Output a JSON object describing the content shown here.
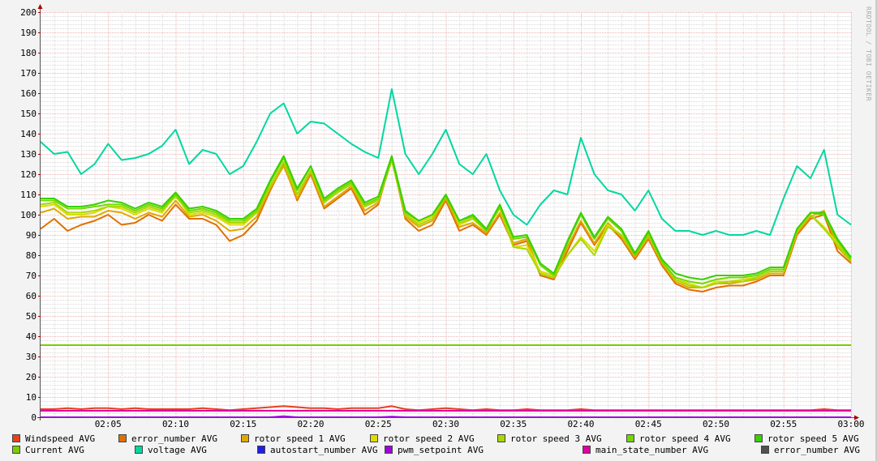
{
  "chart_data": {
    "type": "line",
    "title": "",
    "xlabel": "",
    "ylabel": "",
    "ylim": [
      0,
      200
    ],
    "yticks": [
      "0",
      "10",
      "20",
      "30",
      "40",
      "50",
      "60",
      "70",
      "80",
      "90",
      "100",
      "110",
      "120",
      "130",
      "140",
      "150",
      "160",
      "170",
      "180",
      "190",
      "200"
    ],
    "xticks": [
      "02:05",
      "02:10",
      "02:15",
      "02:20",
      "02:25",
      "02:30",
      "02:35",
      "02:40",
      "02:45",
      "02:50",
      "02:55",
      "03:00"
    ],
    "x_start_minute": 0,
    "x_end_minute": 60,
    "grid": true,
    "legend_position": "bottom",
    "series": [
      {
        "name": "Windspeed AVG",
        "color": "#e8401c",
        "values": [
          4,
          4,
          4.5,
          4,
          4.5,
          4.5,
          4,
          4.5,
          4,
          4,
          4,
          4,
          4.5,
          4,
          3.5,
          4,
          4.5,
          5,
          5.5,
          5,
          4.5,
          4.5,
          4,
          4.5,
          4.5,
          4.5,
          5.5,
          4,
          3.5,
          4,
          4.5,
          4,
          3.5,
          4,
          3.5,
          3.5,
          4,
          3.5,
          3.5,
          3.5,
          4,
          3.5,
          3.5,
          3.5,
          3.5,
          3.5,
          3.5,
          3.5,
          3.5,
          3.5,
          3.5,
          3.5,
          3.5,
          3.5,
          3.5,
          3.5,
          3.5,
          3.5,
          4,
          3.5,
          3.5
        ]
      },
      {
        "name": "error_number AVG",
        "color": "#e07000",
        "values": [
          93,
          98,
          92,
          95,
          97,
          100,
          95,
          96,
          100,
          97,
          105,
          98,
          98,
          95,
          87,
          90,
          97,
          112,
          125,
          107,
          120,
          103,
          108,
          113,
          100,
          105,
          128,
          98,
          92,
          95,
          107,
          92,
          95,
          90,
          100,
          85,
          87,
          70,
          68,
          82,
          96,
          85,
          95,
          88,
          78,
          88,
          75,
          66,
          63,
          62,
          64,
          65,
          65,
          67,
          70,
          70,
          90,
          98,
          100,
          82,
          76
        ]
      },
      {
        "name": "rotor speed 1 AVG",
        "color": "#e0a800",
        "values": [
          101,
          103,
          98,
          99,
          99,
          102,
          101,
          98,
          101,
          99,
          107,
          99,
          100,
          97,
          92,
          93,
          99,
          113,
          124,
          108,
          121,
          104,
          109,
          114,
          102,
          106,
          127,
          99,
          94,
          97,
          108,
          94,
          96,
          91,
          101,
          86,
          88,
          71,
          69,
          84,
          97,
          86,
          96,
          89,
          79,
          89,
          76,
          67,
          64,
          64,
          66,
          66,
          67,
          68,
          71,
          71,
          91,
          99,
          102,
          84,
          77
        ]
      },
      {
        "name": "rotor speed 2 AVG",
        "color": "#dcdc00",
        "values": [
          104,
          105,
          100,
          100,
          101,
          104,
          103,
          100,
          103,
          101,
          110,
          100,
          101,
          99,
          95,
          95,
          101,
          114,
          126,
          110,
          122,
          106,
          111,
          115,
          104,
          108,
          128,
          100,
          96,
          99,
          110,
          95,
          98,
          93,
          103,
          84,
          85,
          72,
          70,
          80,
          89,
          82,
          95,
          90,
          80,
          90,
          77,
          68,
          66,
          64,
          67,
          67,
          68,
          69,
          72,
          72,
          92,
          100,
          94,
          86,
          78
        ]
      },
      {
        "name": "rotor speed 3 AVG",
        "color": "#a8d800",
        "values": [
          105,
          106,
          101,
          101,
          102,
          104,
          104,
          101,
          104,
          102,
          109,
          101,
          102,
          100,
          96,
          96,
          101,
          114,
          126,
          110,
          122,
          106,
          111,
          115,
          104,
          107,
          127,
          100,
          95,
          98,
          109,
          96,
          98,
          92,
          104,
          84,
          83,
          71,
          69,
          80,
          88,
          80,
          94,
          90,
          80,
          90,
          77,
          68,
          65,
          64,
          66,
          67,
          67,
          69,
          72,
          72,
          92,
          100,
          93,
          85,
          77
        ]
      },
      {
        "name": "rotor speed 4 AVG",
        "color": "#70d800",
        "values": [
          107,
          107,
          103,
          103,
          104,
          105,
          105,
          102,
          105,
          103,
          110,
          102,
          103,
          101,
          97,
          97,
          102,
          116,
          128,
          112,
          124,
          107,
          112,
          116,
          105,
          108,
          128,
          101,
          97,
          100,
          109,
          97,
          99,
          92,
          104,
          88,
          89,
          75,
          70,
          86,
          100,
          88,
          98,
          92,
          80,
          91,
          77,
          69,
          67,
          66,
          68,
          69,
          69,
          70,
          73,
          73,
          93,
          101,
          100,
          87,
          78
        ]
      },
      {
        "name": "rotor speed 5 AVG",
        "color": "#38d000",
        "values": [
          108,
          108,
          104,
          104,
          105,
          107,
          106,
          103,
          106,
          104,
          111,
          103,
          104,
          102,
          98,
          98,
          103,
          117,
          129,
          113,
          124,
          108,
          113,
          117,
          106,
          109,
          129,
          102,
          97,
          100,
          110,
          97,
          100,
          93,
          105,
          89,
          90,
          76,
          71,
          87,
          101,
          89,
          99,
          93,
          81,
          92,
          78,
          71,
          69,
          68,
          70,
          70,
          70,
          71,
          74,
          74,
          93,
          101,
          101,
          88,
          79
        ]
      },
      {
        "name": "Current AVG",
        "color": "#7acc00",
        "values": [
          35.6,
          35.6,
          35.6,
          35.6,
          35.6,
          35.6,
          35.6,
          35.6,
          35.6,
          35.6,
          35.6,
          35.6,
          35.6,
          35.6,
          35.6,
          35.6,
          35.6,
          35.6,
          35.6,
          35.6,
          35.6,
          35.6,
          35.6,
          35.6,
          35.6,
          35.6,
          35.6,
          35.6,
          35.6,
          35.6,
          35.6,
          35.6,
          35.6,
          35.6,
          35.6,
          35.6,
          35.6,
          35.6,
          35.6,
          35.6,
          35.6,
          35.6,
          35.6,
          35.6,
          35.6,
          35.6,
          35.6,
          35.6,
          35.6,
          35.6,
          35.6,
          35.6,
          35.6,
          35.6,
          35.6,
          35.6,
          35.6,
          35.6,
          35.6,
          35.6,
          35.6
        ]
      },
      {
        "name": "voltage AVG",
        "color": "#00d8a0",
        "values": [
          136,
          130,
          131,
          120,
          125,
          135,
          127,
          128,
          130,
          134,
          142,
          125,
          132,
          130,
          120,
          124,
          136,
          150,
          155,
          140,
          146,
          145,
          140,
          135,
          131,
          128,
          162,
          130,
          120,
          130,
          142,
          125,
          120,
          130,
          112,
          100,
          95,
          105,
          112,
          110,
          138,
          120,
          112,
          110,
          102,
          112,
          98,
          92,
          92,
          90,
          92,
          90,
          90,
          92,
          90,
          108,
          124,
          118,
          132,
          100,
          95
        ]
      },
      {
        "name": "autostart_number AVG",
        "color": "#2020e0",
        "values": []
      },
      {
        "name": "pwm_setpoint AVG",
        "color": "#a000e0",
        "values": [
          0,
          0,
          0,
          0,
          0,
          0,
          0,
          0,
          0,
          0,
          0,
          0,
          0,
          0,
          0,
          0,
          0,
          0,
          0.5,
          0,
          0,
          0,
          0,
          0,
          0,
          0,
          0.3,
          0,
          0,
          0,
          0,
          0,
          0,
          0,
          0,
          0,
          0,
          0,
          0,
          0,
          0,
          0,
          0,
          0,
          0,
          0,
          0,
          0,
          0,
          0,
          0,
          0,
          0,
          0,
          0,
          0,
          0,
          0,
          0,
          0,
          0
        ]
      },
      {
        "name": "main_state_number AVG",
        "color": "#e000a0",
        "values": [
          3.2,
          3.2,
          3.2,
          3.2,
          3.2,
          3.2,
          3.2,
          3.2,
          3.2,
          3.2,
          3.2,
          3.2,
          3.2,
          3.2,
          3.2,
          3.2,
          3.2,
          3.2,
          3.2,
          3.2,
          3.2,
          3.2,
          3.2,
          3.2,
          3.2,
          3.2,
          3.2,
          3.2,
          3.2,
          3.2,
          3.2,
          3.2,
          3.2,
          3.2,
          3.2,
          3.2,
          3.2,
          3.2,
          3.2,
          3.2,
          3.2,
          3.2,
          3.2,
          3.2,
          3.2,
          3.2,
          3.2,
          3.2,
          3.2,
          3.2,
          3.2,
          3.2,
          3.2,
          3.2,
          3.2,
          3.2,
          3.2,
          3.2,
          3.2,
          3.2,
          3.2
        ]
      },
      {
        "name": "error_number AVG",
        "color": "#505050",
        "values": []
      }
    ],
    "credit": "RRDTOOL / TOBI OETIKER"
  }
}
